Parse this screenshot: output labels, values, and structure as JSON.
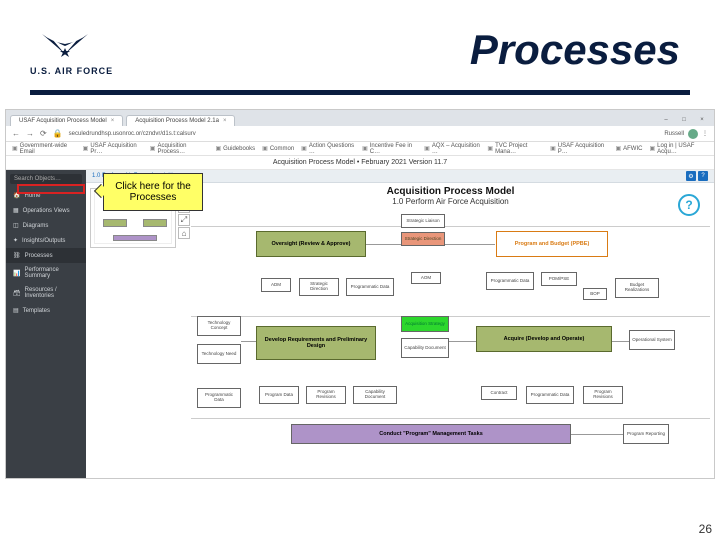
{
  "header": {
    "org": "U.S. AIR FORCE",
    "title": "Processes"
  },
  "browser": {
    "tabs": [
      {
        "label": "USAF Acquisition Process Model"
      },
      {
        "label": "Acquisition Process Model 2.1a"
      }
    ],
    "url": "seculedrundhsp.usonroc.or/czndvr/d1s.t:calsurv",
    "account": "Russell",
    "bookmarks": [
      "Government-wide Email",
      "USAF Acquisition Pr…",
      "Acquisition Process…",
      "Guidebooks",
      "Common",
      "Action Questions …",
      "Incentive Fee in C…",
      "AQX – Acquisition …",
      "TVC Project Mana…",
      "USAF Acquisition P…",
      "AFWIC",
      "Log in | USAF Acqu…"
    ],
    "apptitle": "Acquisition Process Model • February 2021 Version 11.7"
  },
  "sidebar": {
    "search_placeholder": "Search Objects…",
    "items": [
      {
        "label": "Home"
      },
      {
        "label": "Operations Views"
      },
      {
        "label": "Diagrams"
      },
      {
        "label": "Insights/Outputs"
      },
      {
        "label": "Processes"
      },
      {
        "label": "Performance Summary"
      },
      {
        "label": "Resources / Inventories"
      },
      {
        "label": "Templates"
      }
    ]
  },
  "crumb": "1.0 Perform Air Force Acquisition",
  "callout": "Click here for the Processes",
  "pointer_target_index": 4,
  "diagram": {
    "title": "Acquisition Process Model",
    "subtitle": "1.0 Perform Air Force Acquisition",
    "help": "?",
    "main_blocks": [
      {
        "id": "oversight",
        "label": "Oversight (Review & Approve)",
        "style": "b-olive"
      },
      {
        "id": "ppbe",
        "label": "Program and Budget (PPBE)",
        "style": "b-orange"
      },
      {
        "id": "develop",
        "label": "Develop Requirements and Preliminary Design",
        "style": "b-olive"
      },
      {
        "id": "acquire",
        "label": "Acquire (Develop and Operate)",
        "style": "b-olive"
      },
      {
        "id": "conduct",
        "label": "Conduct \"Program\" Management Tasks",
        "style": "b-purple"
      }
    ],
    "small_top": [
      {
        "label": "Strategic Liaison"
      },
      {
        "label": "Strategic Direction",
        "style": "b-salmon"
      }
    ],
    "row2": [
      {
        "label": "ADM"
      },
      {
        "label": "Strategic Direction"
      },
      {
        "label": "Programmatic Data"
      },
      {
        "label": "AOM"
      },
      {
        "label": "Programmatic Data"
      },
      {
        "label": "POM/PSE"
      },
      {
        "label": "BOP"
      },
      {
        "label": "Budget Realizations"
      }
    ],
    "left_col": [
      {
        "label": "Technology Concept"
      },
      {
        "label": "Technology Need"
      },
      {
        "label": "Programmatic Data"
      }
    ],
    "mid_col": [
      {
        "label": "Acquisition Strategy",
        "style": "b-green"
      },
      {
        "label": "Capability Document"
      }
    ],
    "right_col": [
      {
        "label": "Operational System"
      }
    ],
    "row_bottom": [
      {
        "label": "Program Data"
      },
      {
        "label": "Program Revisions"
      },
      {
        "label": "Capability Document"
      },
      {
        "label": "Contract"
      },
      {
        "label": "Programmatic Data"
      },
      {
        "label": "Program Revisions"
      }
    ],
    "far_right": [
      {
        "label": "Program Reporting"
      }
    ]
  },
  "page_number": "26"
}
